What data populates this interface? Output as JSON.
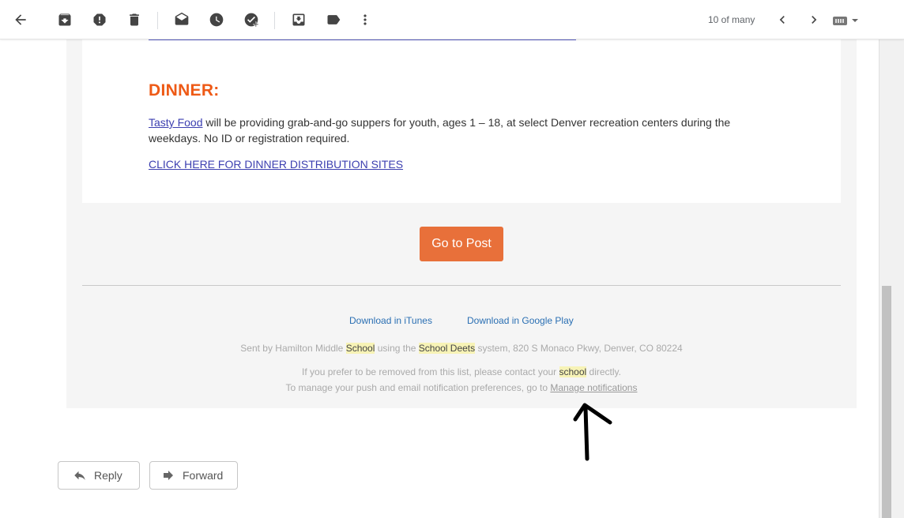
{
  "toolbar": {
    "icons": [
      "back-arrow-icon",
      "archive-icon",
      "report-spam-icon",
      "delete-icon",
      "mark-unread-icon",
      "snooze-icon",
      "add-to-tasks-icon",
      "move-to-icon",
      "label-icon",
      "more-vert-icon"
    ],
    "pager_text": "10 of many"
  },
  "email": {
    "dinner_heading": "DINNER:",
    "dinner_link": "Tasty Food",
    "dinner_text": " will be providing grab-and-go suppers for youth, ages 1 – 18, at select Denver recreation centers during the weekdays. No ID or registration required.",
    "dinner_cta": "CLICK HERE FOR DINNER DISTRIBUTION SITES",
    "go_button": "Go to Post",
    "download_itunes": "Download in iTunes",
    "download_google": "Download in Google Play",
    "sent_by_prefix": "Sent by Hamilton Middle ",
    "sent_by_hl1": "School",
    "sent_by_mid": " using the ",
    "sent_by_hl2": "School Deets",
    "sent_by_suffix": " system, 820 S Monaco Pkwy, Denver, CO 80224",
    "remove_prefix": "If you prefer to be removed from this list, please contact your ",
    "remove_hl": "school",
    "remove_suffix": " directly.",
    "manage_prefix": "To manage your push and email notification preferences, go to ",
    "manage_link": "Manage notifications"
  },
  "actions": {
    "reply": "Reply",
    "forward": "Forward"
  },
  "colors": {
    "accent_orange": "#ee5a16",
    "button_orange": "#e8703a",
    "link_blue": "#2a6fb3",
    "highlight": "#f7f3b6"
  }
}
